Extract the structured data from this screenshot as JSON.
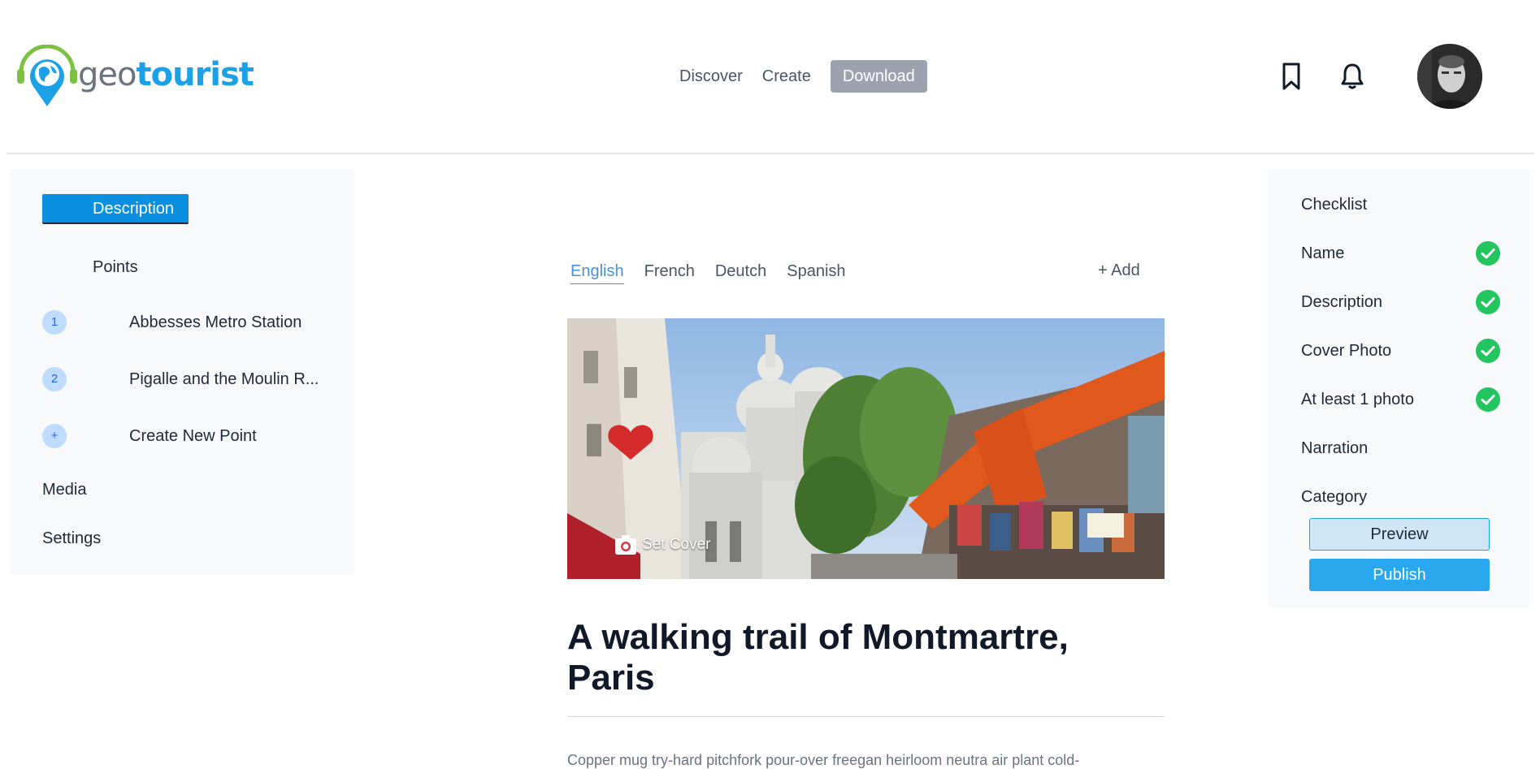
{
  "brand": {
    "name_part1": "geo",
    "name_part2": "tourist",
    "colors": {
      "primary": "#1da1e6",
      "accent_green": "#7cc142",
      "gray": "#6b7280"
    }
  },
  "topnav": {
    "discover": "Discover",
    "create": "Create",
    "download": "Download"
  },
  "header_icons": {
    "bookmark": "bookmark-icon",
    "notifications": "bell-icon",
    "avatar": "avatar"
  },
  "sidebar": {
    "description": "Description",
    "points": "Points",
    "point_items": [
      {
        "num": "1",
        "label": "Abbesses Metro Station"
      },
      {
        "num": "2",
        "label": "Pigalle and the Moulin R..."
      },
      {
        "num": "+",
        "label": "Create New Point"
      }
    ],
    "media": "Media",
    "settings": "Settings"
  },
  "languages": {
    "tabs": [
      "English",
      "French",
      "Deutch",
      "Spanish"
    ],
    "active": "English",
    "add": "+ Add"
  },
  "cover": {
    "set_cover": "Set Cover"
  },
  "tour": {
    "title": "A walking trail of Montmartre, Paris",
    "body_excerpt": "Copper mug try-hard pitchfork pour-over freegan heirloom neutra air plant cold-"
  },
  "checklist": {
    "heading": "Checklist",
    "items": [
      {
        "label": "Name",
        "done": true
      },
      {
        "label": "Description",
        "done": true
      },
      {
        "label": "Cover Photo",
        "done": true
      },
      {
        "label": "At least 1 photo",
        "done": true
      },
      {
        "label": "Narration",
        "done": false
      },
      {
        "label": "Category",
        "done": false
      }
    ],
    "check_color": "#22c55e"
  },
  "actions": {
    "preview": "Preview",
    "publish": "Publish"
  }
}
